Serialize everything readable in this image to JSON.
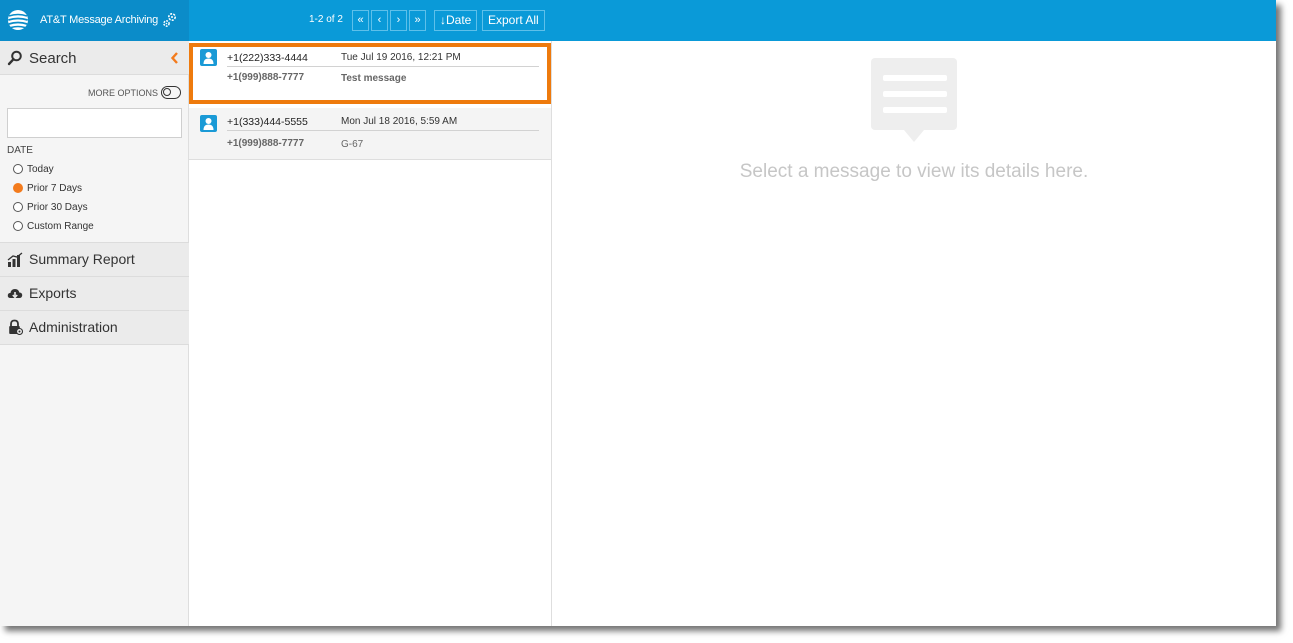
{
  "app": {
    "title": "AT&T Message Archiving"
  },
  "toolbar": {
    "page_count": "1-2 of 2",
    "first_icon": "«",
    "prev_icon": "‹",
    "next_icon": "›",
    "last_icon": "»",
    "sort_label": "↓Date",
    "export_all_label": "Export All"
  },
  "sidebar": {
    "search_label": "Search",
    "more_options_label": "MORE OPTIONS",
    "search_value": "",
    "date_label": "DATE",
    "date_options": [
      {
        "label": "Today",
        "checked": false
      },
      {
        "label": "Prior 7 Days",
        "checked": true
      },
      {
        "label": "Prior 30 Days",
        "checked": false
      },
      {
        "label": "Custom Range",
        "checked": false
      }
    ],
    "nav": [
      {
        "label": "Summary Report",
        "icon": "bar-chart-icon"
      },
      {
        "label": "Exports",
        "icon": "cloud-download-icon"
      },
      {
        "label": "Administration",
        "icon": "lock-icon"
      }
    ]
  },
  "messages": [
    {
      "from": "+1(222)333-4444",
      "date": "Tue Jul 19 2016, 12:21 PM",
      "to": "+1(999)888-7777",
      "text": "Test message",
      "selected": true
    },
    {
      "from": "+1(333)444-5555",
      "date": "Mon Jul 18 2016, 5:59 AM",
      "to": "+1(999)888-7777",
      "text": "G-67",
      "selected": false
    }
  ],
  "detail": {
    "placeholder": "Select a message to view its details here."
  },
  "colors": {
    "brand_blue": "#0a9ad8",
    "selection_orange": "#ee7a0d",
    "radio_orange": "#f37b1d"
  }
}
